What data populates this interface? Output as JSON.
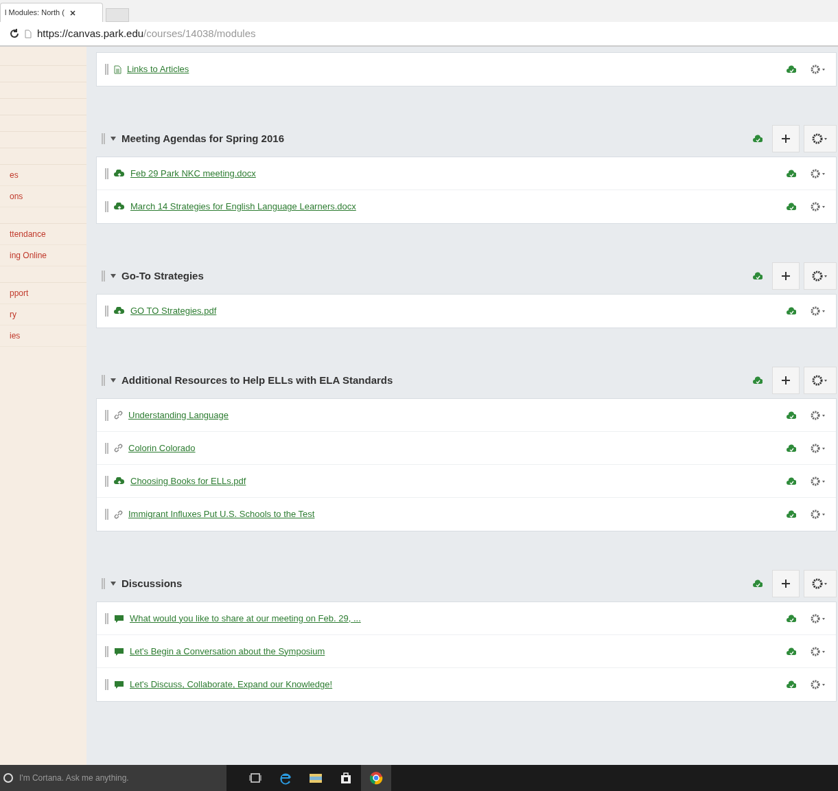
{
  "browser": {
    "tab_title": "l Modules: North (",
    "url_host": "https://canvas.park.edu",
    "url_path": "/courses/14038/modules"
  },
  "sidebar": {
    "items": [
      {
        "label": "es",
        "selected": false
      },
      {
        "label": "ons",
        "selected": false
      },
      {
        "label": "ttendance",
        "selected": false
      },
      {
        "label": "ing Online",
        "selected": false
      },
      {
        "label": "pport",
        "selected": false
      },
      {
        "label": "ry",
        "selected": false
      },
      {
        "label": "ies",
        "selected": false
      }
    ]
  },
  "modules": [
    {
      "items": [
        {
          "kind": "page",
          "title": "Links to Articles"
        }
      ]
    },
    {
      "title": "Meeting Agendas for Spring 2016",
      "items": [
        {
          "kind": "file",
          "title": "Feb 29 Park NKC meeting.docx"
        },
        {
          "kind": "file",
          "title": "March 14 Strategies for English Language Learners.docx"
        }
      ]
    },
    {
      "title": "Go-To Strategies",
      "items": [
        {
          "kind": "file",
          "title": "GO TO Strategies.pdf"
        }
      ]
    },
    {
      "title": "Additional Resources to Help ELLs with ELA Standards",
      "items": [
        {
          "kind": "link",
          "title": "Understanding Language"
        },
        {
          "kind": "link",
          "title": "Colorin Colorado"
        },
        {
          "kind": "file",
          "title": "Choosing Books for ELLs.pdf"
        },
        {
          "kind": "link",
          "title": "Immigrant Influxes Put U.S. Schools to the Test"
        }
      ]
    },
    {
      "title": "Discussions",
      "items": [
        {
          "kind": "discussion",
          "title": "What would you like to share at our meeting on Feb. 29, ..."
        },
        {
          "kind": "discussion",
          "title": "Let's Begin a Conversation about the Symposium"
        },
        {
          "kind": "discussion",
          "title": "Let's Discuss, Collaborate, Expand our Knowledge!"
        }
      ]
    }
  ],
  "taskbar": {
    "search_placeholder": "I'm Cortana. Ask me anything."
  }
}
